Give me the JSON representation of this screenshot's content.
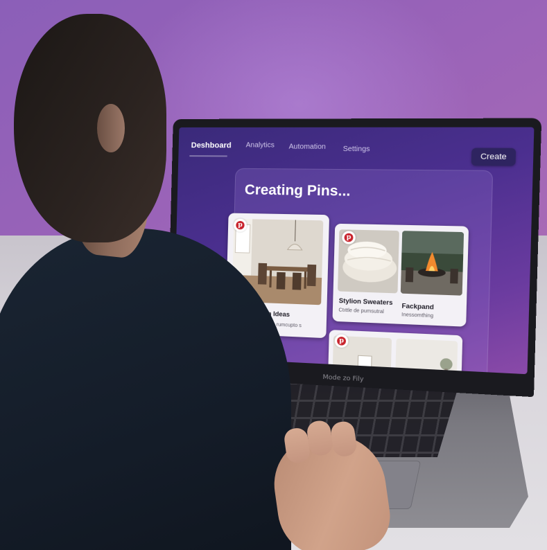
{
  "nav": {
    "tabs": [
      {
        "label": "Deshboard",
        "active": true
      },
      {
        "label": "Analytics",
        "active": false
      },
      {
        "label": "Automation",
        "active": false
      },
      {
        "label": "Settings",
        "active": false
      }
    ],
    "create_label": "Create"
  },
  "panel": {
    "title": "Creating Pins..."
  },
  "cards": [
    {
      "title": "Dining Room Ideas",
      "subtitle": "Cŏax – ncœn-phino rumcupto s",
      "icon": "pinterest-icon"
    },
    {
      "title": "Stylion Sweaters",
      "subtitle": "Ctıttle de pumsutral",
      "icon": "pinterest-icon"
    },
    {
      "title": "Fackpand",
      "subtitle": "Inessomthing",
      "icon": "pinterest-icon"
    },
    {
      "title": "",
      "subtitle": "",
      "icon": "pinterest-icon"
    }
  ],
  "laptop": {
    "chin_label": "Mode zo Fily"
  },
  "colors": {
    "wall": "#9a63b8",
    "screen_bg": "#4b2f8f",
    "create_button": "#2e2460",
    "pin_red": "#c8232c"
  }
}
